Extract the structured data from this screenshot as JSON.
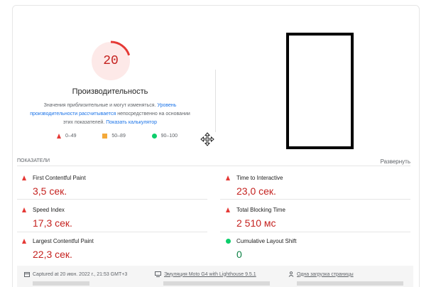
{
  "performance": {
    "score": "20",
    "score_fraction": 0.2,
    "title": "Производительность",
    "desc_text1": "Значения приблизительные и могут изменяться.",
    "desc_link1": "Уровень производительности рассчитывается",
    "desc_text2": "непосредственно на основании этих показателей.",
    "desc_link2": "Показать калькулятор"
  },
  "legend": {
    "poor": "0–49",
    "average": "50–89",
    "good": "90–100"
  },
  "metrics": {
    "header": "ПОКАЗАТЕЛИ",
    "expand_label": "Развернуть",
    "items": [
      {
        "name": "First Contentful Paint",
        "value": "3,5 сек.",
        "status": "poor"
      },
      {
        "name": "Time to Interactive",
        "value": "23,0 сек.",
        "status": "poor"
      },
      {
        "name": "Speed Index",
        "value": "17,3 сек.",
        "status": "poor"
      },
      {
        "name": "Total Blocking Time",
        "value": "2 510 мс",
        "status": "poor"
      },
      {
        "name": "Largest Contentful Paint",
        "value": "22,3 сек.",
        "status": "poor"
      },
      {
        "name": "Cumulative Layout Shift",
        "value": "0",
        "status": "good"
      }
    ]
  },
  "footer": {
    "captured": "Captured at 20 июн. 2022 г., 21:53 GMT+3",
    "emulation": "Эмуляция Moto G4 with Lighthouse 9.5.1",
    "single_load": "Одна загрузка страницы"
  },
  "colors": {
    "poor": "#e53935",
    "average": "#f4a93a",
    "good": "#0cce6b",
    "poor_text": "#c5221f",
    "good_text": "#0a8043",
    "link": "#1a73e8"
  }
}
